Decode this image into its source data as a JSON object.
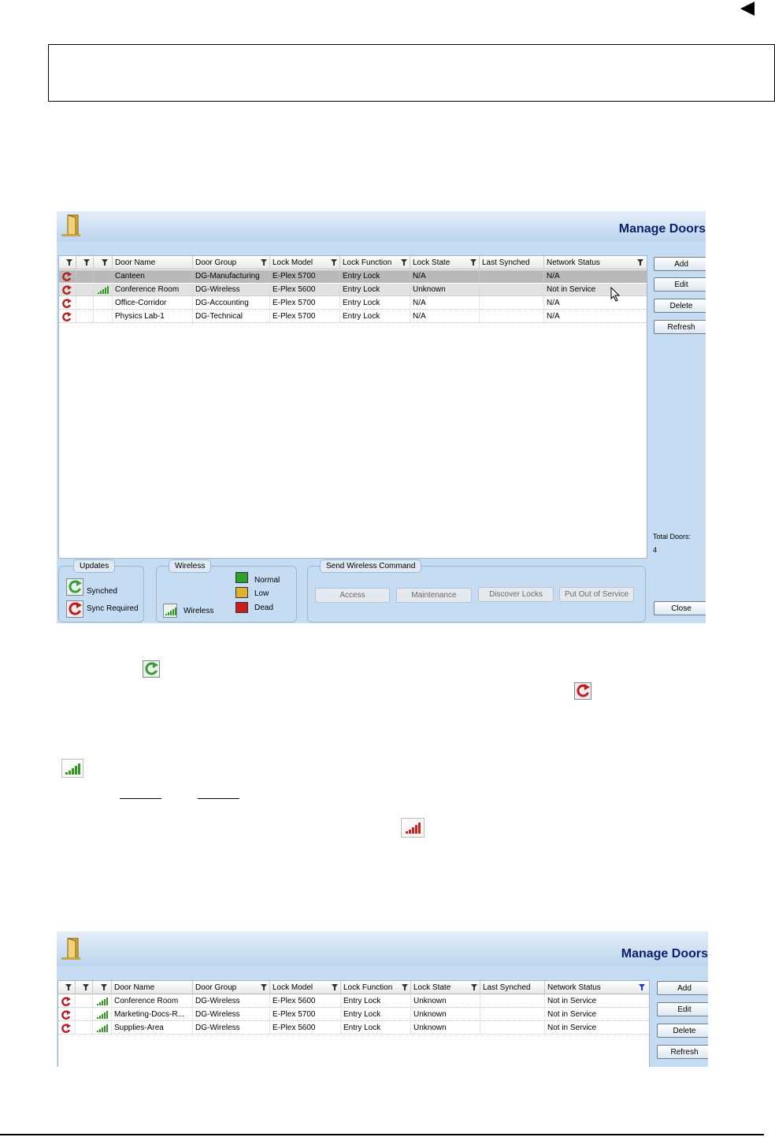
{
  "window1": {
    "title": "Manage Doors",
    "columns": [
      "Door Name",
      "Door Group",
      "Lock Model",
      "Lock Function",
      "Lock State",
      "Last Synched",
      "Network Status"
    ],
    "rows": [
      {
        "name": "Canteen",
        "group": "DG-Manufacturing",
        "model": "E-Plex 5700",
        "function": "Entry Lock",
        "state": "N/A",
        "synched": "",
        "network": "N/A",
        "wireless": false
      },
      {
        "name": "Conference Room",
        "group": "DG-Wireless",
        "model": "E-Plex 5600",
        "function": "Entry Lock",
        "state": "Unknown",
        "synched": "",
        "network": "Not in Service",
        "wireless": true
      },
      {
        "name": "Office-Corridor",
        "group": "DG-Accounting",
        "model": "E-Plex 5700",
        "function": "Entry Lock",
        "state": "N/A",
        "synched": "",
        "network": "N/A",
        "wireless": false
      },
      {
        "name": "Physics Lab-1",
        "group": "DG-Technical",
        "model": "E-Plex 5700",
        "function": "Entry Lock",
        "state": "N/A",
        "synched": "",
        "network": "N/A",
        "wireless": false
      }
    ],
    "buttons": {
      "add": "Add",
      "edit": "Edit",
      "delete": "Delete",
      "refresh": "Refresh",
      "close": "Close"
    },
    "total_label": "Total Doors:",
    "total_value": "4",
    "updates_legend": {
      "title": "Updates",
      "synched": "Synched",
      "sync_required": "Sync Required"
    },
    "wireless_legend": {
      "title": "Wireless",
      "wireless": "Wireless",
      "normal": "Normal",
      "low": "Low",
      "dead": "Dead"
    },
    "command_legend": {
      "title": "Send Wireless Command",
      "access": "Access",
      "maintenance": "Maintenance",
      "discover": "Discover Locks",
      "out_of_service": "Put Out of Service"
    }
  },
  "window2": {
    "title": "Manage Doors",
    "columns": [
      "Door Name",
      "Door Group",
      "Lock Model",
      "Lock Function",
      "Lock State",
      "Last Synched",
      "Network Status"
    ],
    "rows": [
      {
        "name": "Conference Room",
        "group": "DG-Wireless",
        "model": "E-Plex 5600",
        "function": "Entry Lock",
        "state": "Unknown",
        "synched": "",
        "network": "Not in Service"
      },
      {
        "name": "Marketing-Docs-R...",
        "group": "DG-Wireless",
        "model": "E-Plex 5700",
        "function": "Entry Lock",
        "state": "Unknown",
        "synched": "",
        "network": "Not in Service"
      },
      {
        "name": "Supplies-Area",
        "group": "DG-Wireless",
        "model": "E-Plex 5600",
        "function": "Entry Lock",
        "state": "Unknown",
        "synched": "",
        "network": "Not in Service"
      }
    ],
    "buttons": {
      "add": "Add",
      "edit": "Edit",
      "delete": "Delete",
      "refresh": "Refresh"
    }
  },
  "colors": {
    "synched_green": "#3b9a3b",
    "sync_red": "#b51f1f",
    "signal_green": "#2e9a1f",
    "signal_red": "#d02020",
    "title_blue": "#0a1f6e"
  }
}
